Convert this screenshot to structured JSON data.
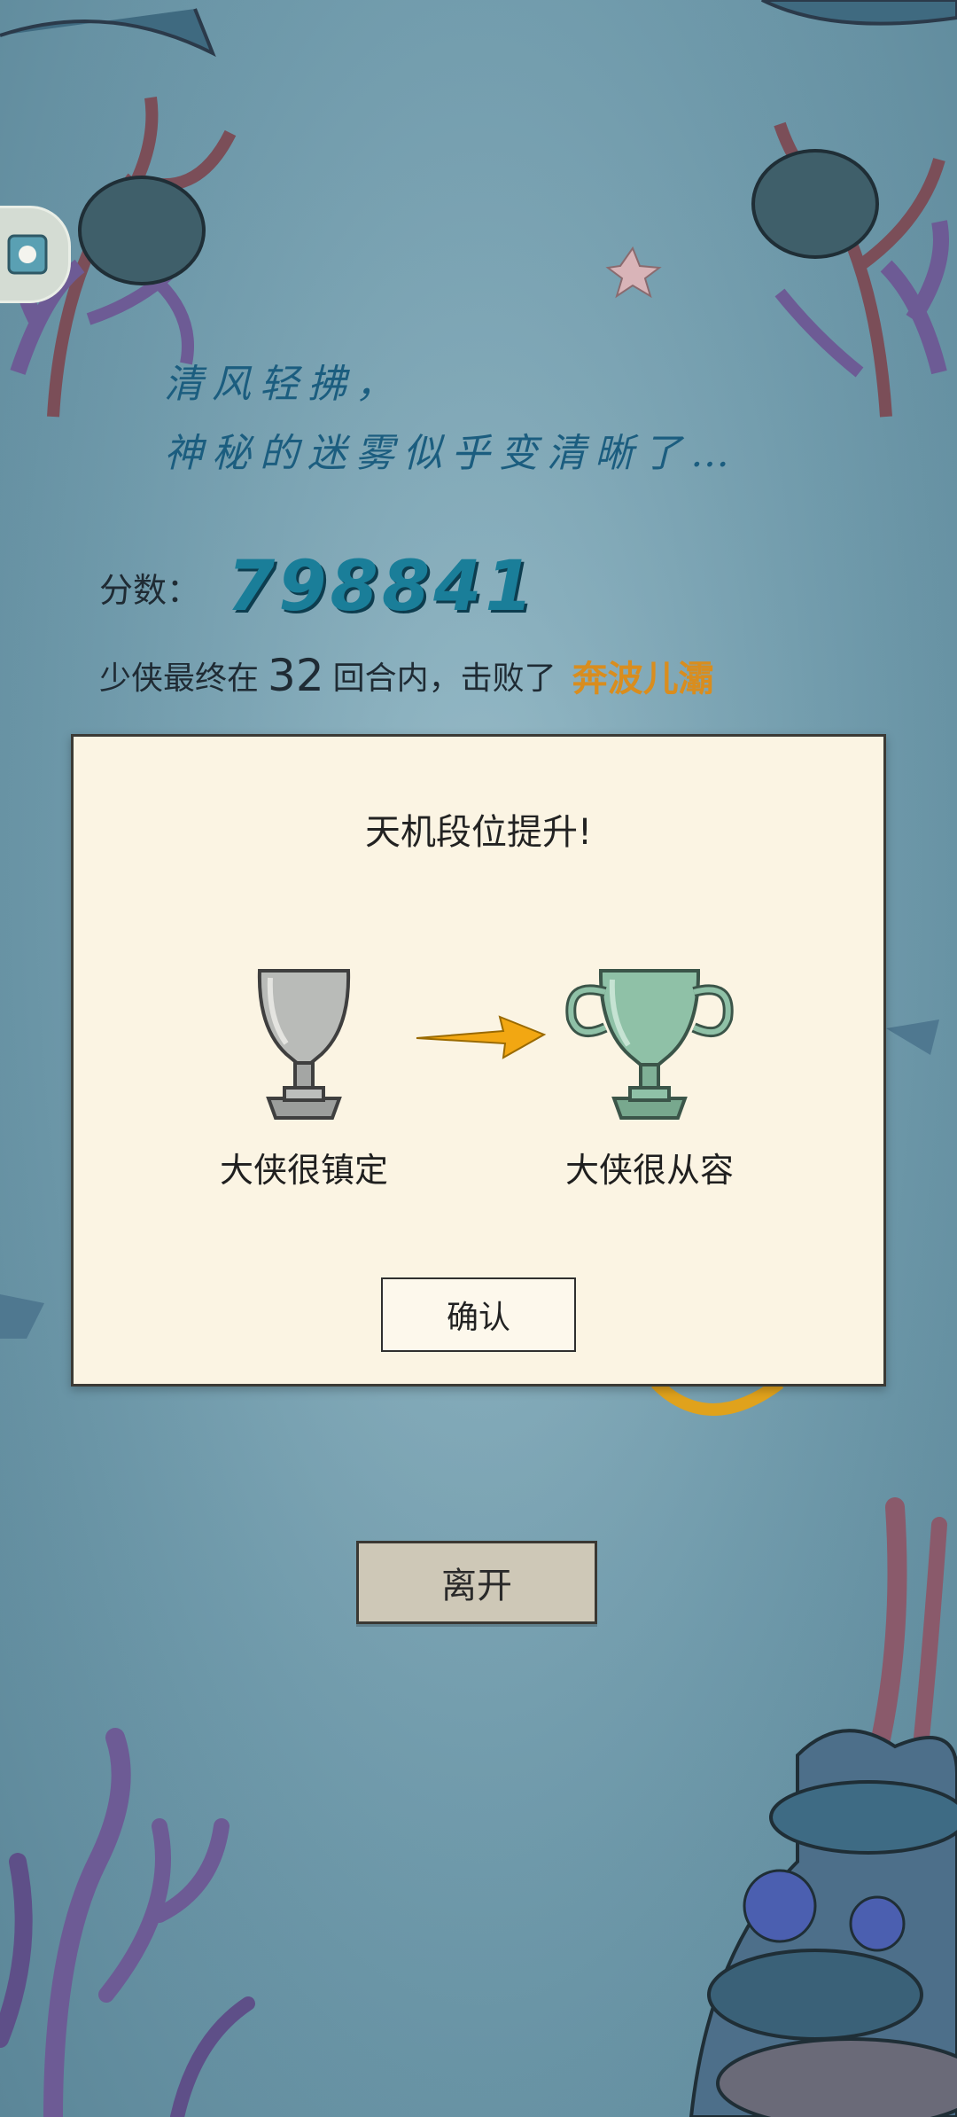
{
  "poem": {
    "line1": "清风轻拂，",
    "line2": "神秘的迷雾似乎变清晰了…"
  },
  "score": {
    "label": "分数：",
    "value": "798841"
  },
  "result": {
    "prefix": "少侠最终在",
    "rounds": "32",
    "middle": "回合内，击败了",
    "boss": "奔波儿灞"
  },
  "dialog": {
    "title": "天机段位提升!",
    "from_rank": "大侠很镇定",
    "to_rank": "大侠很从容",
    "confirm_label": "确认"
  },
  "leave_label": "离开",
  "colors": {
    "accent_score": "#1a7e99",
    "boss_name": "#d98d1e",
    "dialog_bg": "#fbf4e3",
    "arrow": "#f2a712"
  }
}
